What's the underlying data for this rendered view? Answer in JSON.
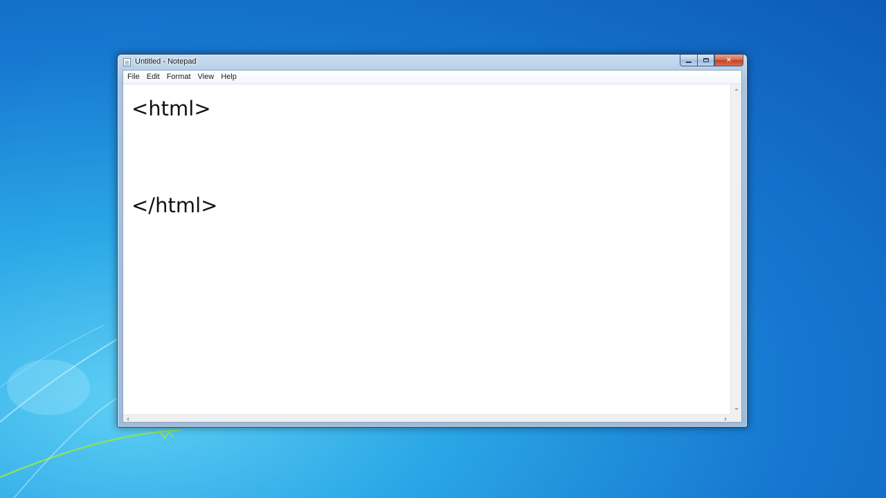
{
  "window": {
    "title": "Untitled - Notepad",
    "close_glyph": "✕"
  },
  "menu": {
    "file": "File",
    "edit": "Edit",
    "format": "Format",
    "view": "View",
    "help": "Help"
  },
  "editor": {
    "content": "<html>\n\n</html>"
  },
  "icons": {
    "app": "notepad-icon",
    "minimize": "minimize-icon",
    "maximize": "maximize-icon",
    "close": "close-icon"
  },
  "colors": {
    "desktop_primary": "#1677d0",
    "close_button": "#c2401f"
  }
}
